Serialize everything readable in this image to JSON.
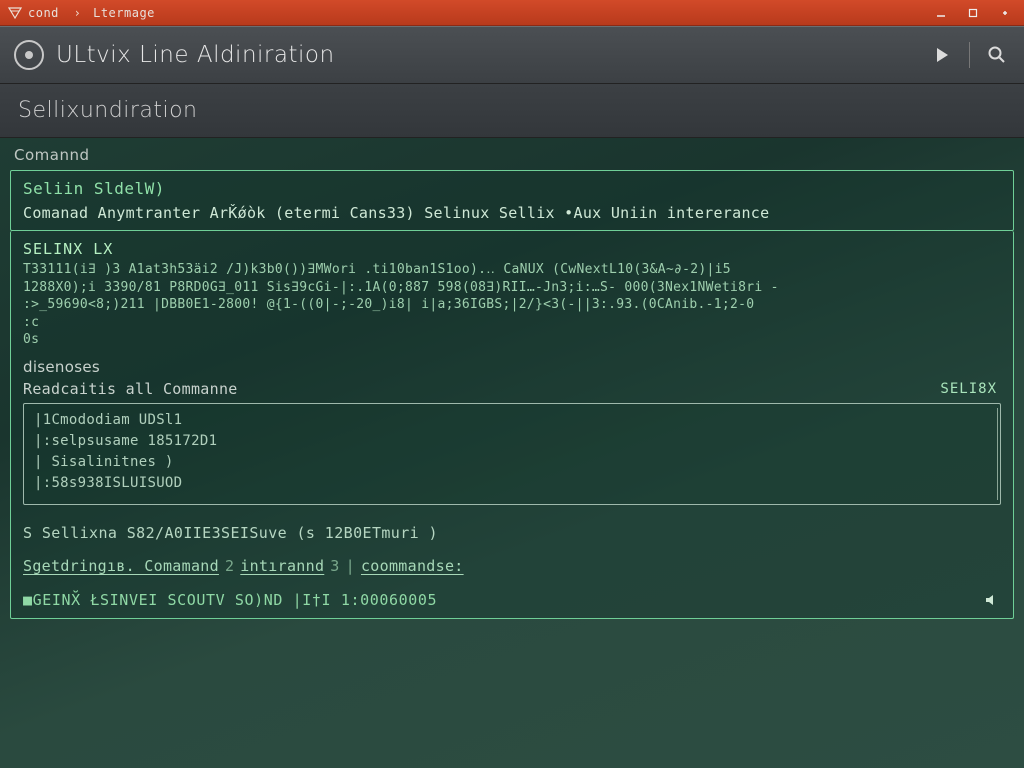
{
  "titlebar": {
    "icon_label": "app-glyph",
    "part1": "cond",
    "part2": "Ltermage"
  },
  "header": {
    "app_title": "ULtvix Line Aldiniration"
  },
  "subheader": {
    "title": "Sellixundiration"
  },
  "terminal": {
    "label": "Comannd",
    "top_panel": {
      "line1": "Seliin SldelW)",
      "line2": "Comanad Anymtranter ArǨǿòk (etermi Cans33) Selinux Sellix •Aux Uniin intererance"
    },
    "block": {
      "head": "SELINX LX",
      "garble1": "T33111(i∃ )3 A1at3h53äi2 /J)k3b0())∃MWori .ti10ban1S1oo).‥ CaNUX (CwNextL10(3&A~∂-2)|i5",
      "garble2": "1288X0);i 3390/81 P8RD0G∃_011 Sis∃9cGi-|:.1A(0;887 598(08∃)RII…-Jn3;i:…S- 000(3Nex1NWeti8ri -",
      "garble3": ":>_59690<8;)211 |DBB0E1-2800! @{1-((0|-;-20_)i8| i|a;36IGBS;|2/}<3(-||3:.93.(0CAnib.-1;2-0",
      "prompt": ":c",
      "zeros": "0s"
    },
    "sub_labels": {
      "l1": "disenoses",
      "l2": "Readcaitis all Commanne",
      "right_tag": "SELI8X"
    },
    "list": [
      "|1Cmododiam UDSl1",
      "|:selpsusame 185172D1",
      "| Sisalinitnes )",
      "|:58s938ISLUISUOD"
    ],
    "footer": "S Sellixna S82/A0IIE3SEISuve (s 12B0ETmuri )",
    "links": {
      "l1": "Sgetdringıв. Comamand",
      "s1": "2",
      "l2": "intırannd",
      "s2": "3",
      "s3": "|",
      "l3": "coommandse:"
    },
    "status": "■GEINX̆ ŁSINVEI SCOUTV SO)ND |I†I 1:00060005"
  }
}
